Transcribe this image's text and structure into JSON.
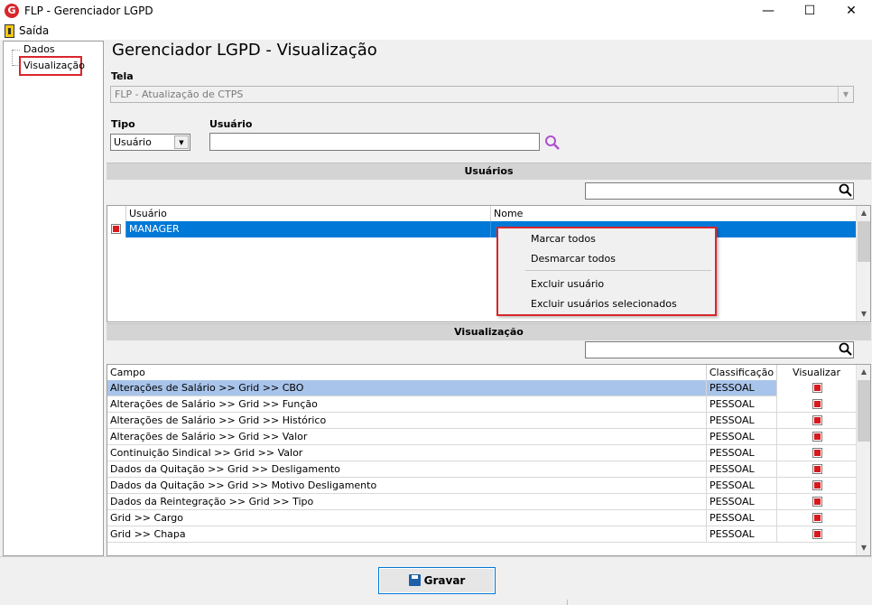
{
  "window": {
    "title": "FLP - Gerenciador LGPD",
    "icon_letter": "G",
    "minimize": "—",
    "maximize": "☐",
    "close": "✕"
  },
  "menu": {
    "exit_label": "Saída"
  },
  "tree": {
    "items": [
      "Dados",
      "Visualização"
    ]
  },
  "main": {
    "title": "Gerenciador LGPD - Visualização",
    "tela_label": "Tela",
    "tela_value": "FLP - Atualização de CTPS",
    "tipo_label": "Tipo",
    "tipo_value": "Usuário",
    "usuario_label": "Usuário",
    "usuario_value": ""
  },
  "users_section": {
    "title": "Usuários",
    "filter_value": "",
    "columns": [
      "Usuário",
      "Nome"
    ],
    "rows": [
      {
        "usuario": "MANAGER",
        "nome": "",
        "checked": true
      }
    ]
  },
  "context_menu": {
    "items": [
      "Marcar todos",
      "Desmarcar todos",
      "Excluir usuário",
      "Excluir usuários selecionados"
    ]
  },
  "vis_section": {
    "title": "Visualização",
    "filter_value": "",
    "columns": [
      "Campo",
      "Classificação",
      "Visualizar"
    ],
    "rows": [
      {
        "campo": "Alterações de Salário >> Grid >> CBO",
        "classificacao": "PESSOAL",
        "visualizar": true
      },
      {
        "campo": "Alterações de Salário >> Grid >> Função",
        "classificacao": "PESSOAL",
        "visualizar": true
      },
      {
        "campo": "Alterações de Salário >> Grid >> Histórico",
        "classificacao": "PESSOAL",
        "visualizar": true
      },
      {
        "campo": "Alterações de Salário >> Grid >> Valor",
        "classificacao": "PESSOAL",
        "visualizar": true
      },
      {
        "campo": "Continuição Sindical >> Grid >> Valor",
        "classificacao": "PESSOAL",
        "visualizar": true
      },
      {
        "campo": "Dados da Quitação >> Grid >> Desligamento",
        "classificacao": "PESSOAL",
        "visualizar": true
      },
      {
        "campo": "Dados da Quitação >> Grid >> Motivo Desligamento",
        "classificacao": "PESSOAL",
        "visualizar": true
      },
      {
        "campo": "Dados da Reintegração >> Grid >> Tipo",
        "classificacao": "PESSOAL",
        "visualizar": true
      },
      {
        "campo": "Grid >> Cargo",
        "classificacao": "PESSOAL",
        "visualizar": true
      },
      {
        "campo": "Grid >> Chapa",
        "classificacao": "PESSOAL",
        "visualizar": true
      }
    ]
  },
  "footer": {
    "save_label": "Gravar"
  },
  "colors": {
    "selection": "#0078d7",
    "selection_light": "#a9c4ea",
    "highlight_border": "#d9262b",
    "check": "#d7191c"
  }
}
